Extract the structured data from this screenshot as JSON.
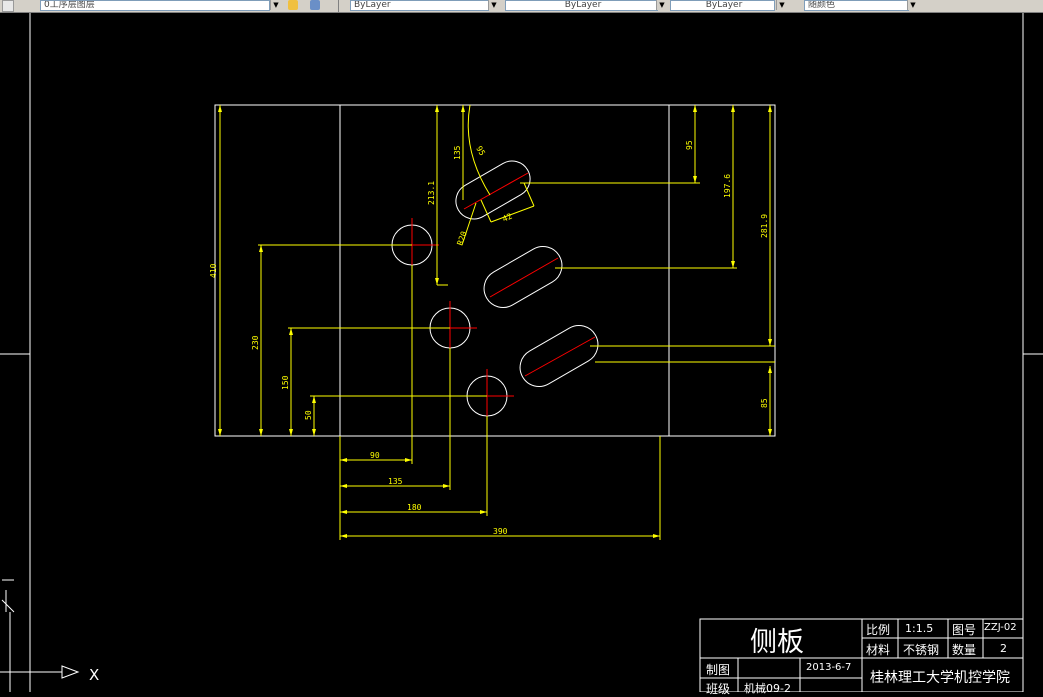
{
  "toolbar": {
    "layer_name": "0工序层图层",
    "color": "ByLayer",
    "linetype": "ByLayer",
    "lineweight": "ByLayer",
    "plot_style": "随颜色"
  },
  "dimensions": {
    "total_height": "410",
    "vertical_left_1": "230",
    "vertical_left_2": "150",
    "vertical_left_3": "50",
    "horizontal_1": "90",
    "horizontal_2": "135",
    "horizontal_3": "180",
    "total_width": "390",
    "top_offset": "213.1",
    "slot_depth": "135",
    "slot_angle": "95",
    "slot_width": "42",
    "slot_radius": "R20",
    "right_1": "95",
    "right_2": "197.6",
    "right_3": "281.9",
    "right_bottom": "85"
  },
  "title_block": {
    "part_name": "侧板",
    "scale_label": "比例",
    "scale_value": "1:1.5",
    "drawing_no_label": "图号",
    "drawing_no_value": "ZZJ-02",
    "material_label": "材料",
    "material_value": "不锈钢",
    "quantity_label": "数量",
    "quantity_value": "2",
    "drawn_by_label": "制图",
    "date": "2013-6-7",
    "class_label": "班级",
    "class_value": "机械09-2",
    "school": "桂林理工大学机控学院"
  },
  "ucs": {
    "x_label": "X",
    "y_label": "Y"
  },
  "colors": {
    "background": "#000000",
    "geometry": "#ffffff",
    "dimension": "#ffff00",
    "centerline": "#ff0000"
  }
}
